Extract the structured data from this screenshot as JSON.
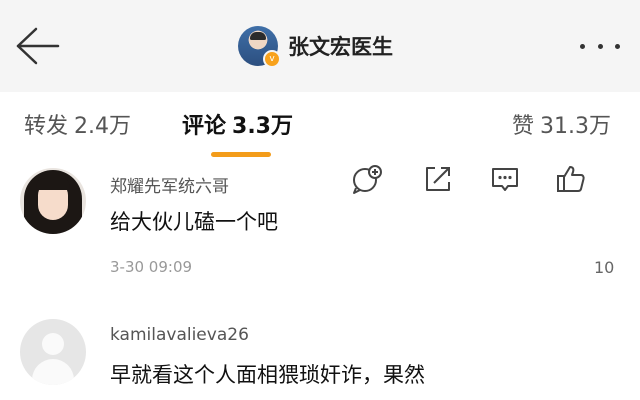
{
  "header": {
    "title": "张文宏医生",
    "back_icon": "arrow-left-icon",
    "more_icon": "more-dots-icon",
    "verify_badge": "v"
  },
  "tabs": [
    {
      "label": "转发",
      "count": "2.4万",
      "active": false
    },
    {
      "label": "评论",
      "count": "3.3万",
      "active": true
    },
    {
      "label": "赞",
      "count": "31.3万",
      "active": false
    }
  ],
  "accent_color": "#f39c1a",
  "comments": [
    {
      "username": "郑耀先军统六哥",
      "text": "给大伙儿磕一个吧",
      "time": "3-30 09:09",
      "like_count": "10",
      "actions": [
        "reply-icon",
        "share-icon",
        "comment-icon",
        "thumbs-up-icon"
      ]
    },
    {
      "username": "kamilavalieva26",
      "text": "早就看这个人面相猥琐奸诈，果然"
    }
  ]
}
